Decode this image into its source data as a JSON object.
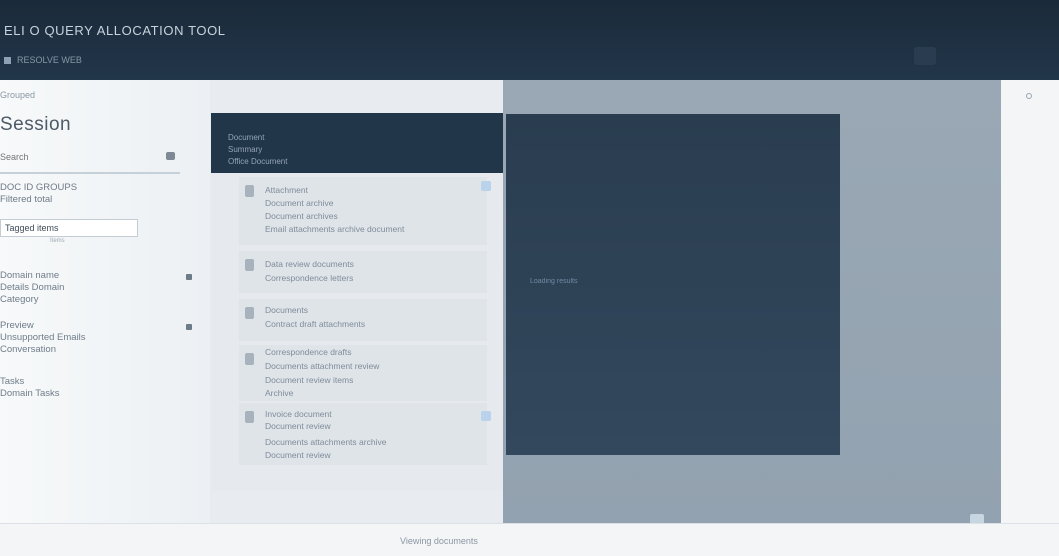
{
  "header": {
    "title": "ELI  O QUERY ALLOCATION TOOL",
    "subtitle": "RESOLVE WEB"
  },
  "left_panel": {
    "breadcrumb": "Grouped",
    "title": "Session",
    "search": {
      "placeholder": "Search"
    },
    "filter_label_lines": [
      "DOC ID GROUPS",
      "Filtered total"
    ],
    "filter_chip": "Tagged items",
    "filter_caption": "Items",
    "groups": [
      {
        "lines": [
          "Domain name",
          "Details Domain",
          "Category"
        ]
      },
      {
        "lines": [
          "Preview",
          "Unsupported Emails",
          "Conversation"
        ]
      },
      {
        "lines": [
          "Tasks",
          "Domain Tasks"
        ]
      }
    ]
  },
  "list_card": {
    "header_lines": [
      "Document",
      "Summary",
      "Office Document"
    ],
    "items": [
      {
        "lines": [
          "Attachment",
          "Document archive",
          "Document archives",
          "Email attachments archive document"
        ],
        "checked": true
      },
      {
        "lines": [
          "Data review documents",
          "Correspondence letters"
        ],
        "checked": false
      },
      {
        "lines": [
          "Documents",
          "Contract draft attachments"
        ],
        "checked": false
      },
      {
        "lines": [
          "Correspondence drafts",
          "Documents attachment review",
          "Document review items",
          "Archive"
        ],
        "checked": false
      },
      {
        "lines": [
          "Invoice document",
          "Document review",
          "Documents attachments archive",
          "Document review"
        ],
        "checked": true
      }
    ]
  },
  "overlay": {
    "line": "Loading results"
  },
  "status_bar": {
    "text": "Viewing documents"
  },
  "colors": {
    "header_bg": "#1a2a39",
    "card_header": "#22364a",
    "overlay_bg": "#2a3d50",
    "right_panel": "#9aa8b5",
    "page_bg": "#eef1f4"
  }
}
